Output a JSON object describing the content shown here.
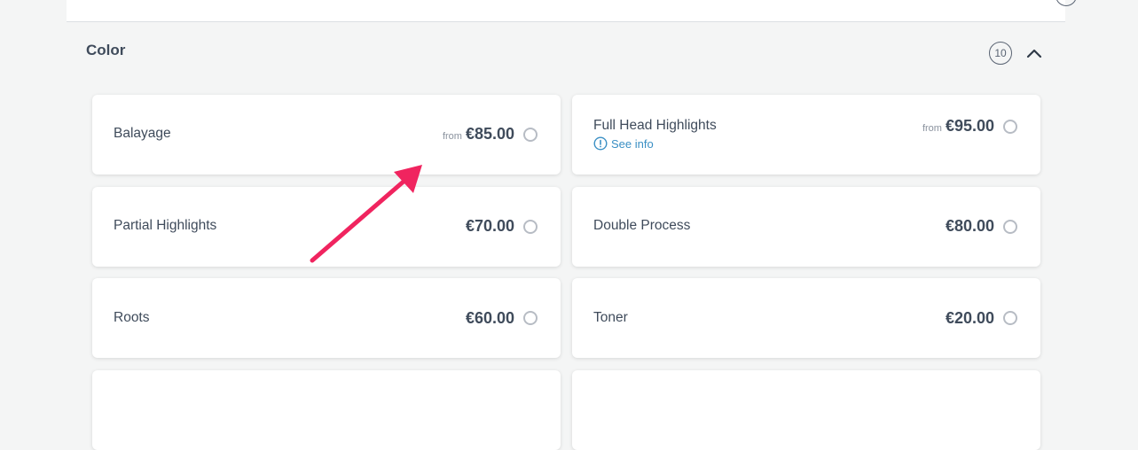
{
  "section": {
    "title": "Color",
    "count": "10"
  },
  "services": [
    {
      "name": "Balayage",
      "from": "from",
      "price": "€85.00"
    },
    {
      "name": "Full Head Highlights",
      "from": "from",
      "price": "€95.00",
      "info": "See info"
    },
    {
      "name": "Partial Highlights",
      "from": "",
      "price": "€70.00"
    },
    {
      "name": "Double Process",
      "from": "",
      "price": "€80.00"
    },
    {
      "name": "Roots",
      "from": "",
      "price": "€60.00"
    },
    {
      "name": "Toner",
      "from": "",
      "price": "€20.00"
    }
  ],
  "colors": {
    "accent_link": "#3a8fc4",
    "annotation_arrow": "#f0245f",
    "text": "#3f4b5b"
  }
}
